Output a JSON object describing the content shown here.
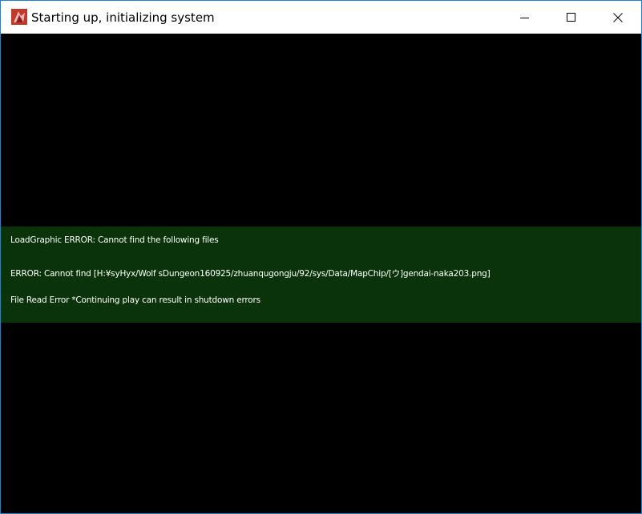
{
  "window": {
    "title": "Starting up, initializing system",
    "border_color": "#1883d7",
    "controls": [
      "minimize-icon",
      "maximize-icon",
      "close-icon"
    ]
  },
  "error_panel": {
    "background": "#0a330a",
    "lines": [
      "LoadGraphic ERROR: Cannot find the following files",
      "ERROR: Cannot find [H:¥syHyx/Wolf sDungeon160925/zhuanqugongju/92/sys/Data/MapChip/[ウ]gendai-naka203.png]",
      "File Read Error *Continuing play can result in shutdown errors"
    ]
  }
}
